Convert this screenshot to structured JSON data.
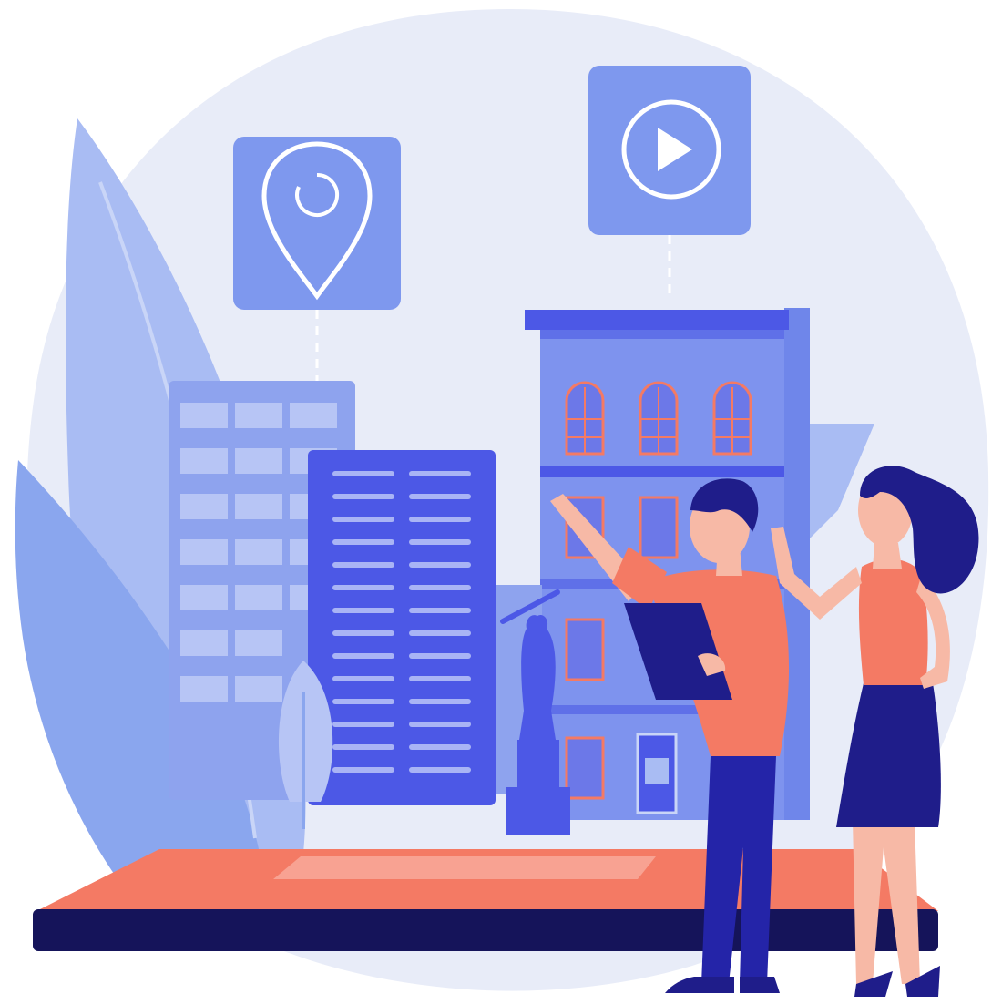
{
  "illustration": {
    "colors": {
      "background_blob": "#e8ecf8",
      "leaf_light": "#a9bcf3",
      "leaf_mid": "#8aa6ee",
      "building_light": "#8ea3ee",
      "building_mid": "#6f86ea",
      "building_dark": "#4c58e6",
      "accent_coral": "#f47a64",
      "navy": "#15145a",
      "skin": "#f7b9a6",
      "hair": "#1f1d8a",
      "icon_tile": "#7e98ee",
      "icon_stroke": "#ffffff"
    },
    "icons": {
      "pin": "map-pin-icon",
      "play": "play-icon"
    }
  }
}
